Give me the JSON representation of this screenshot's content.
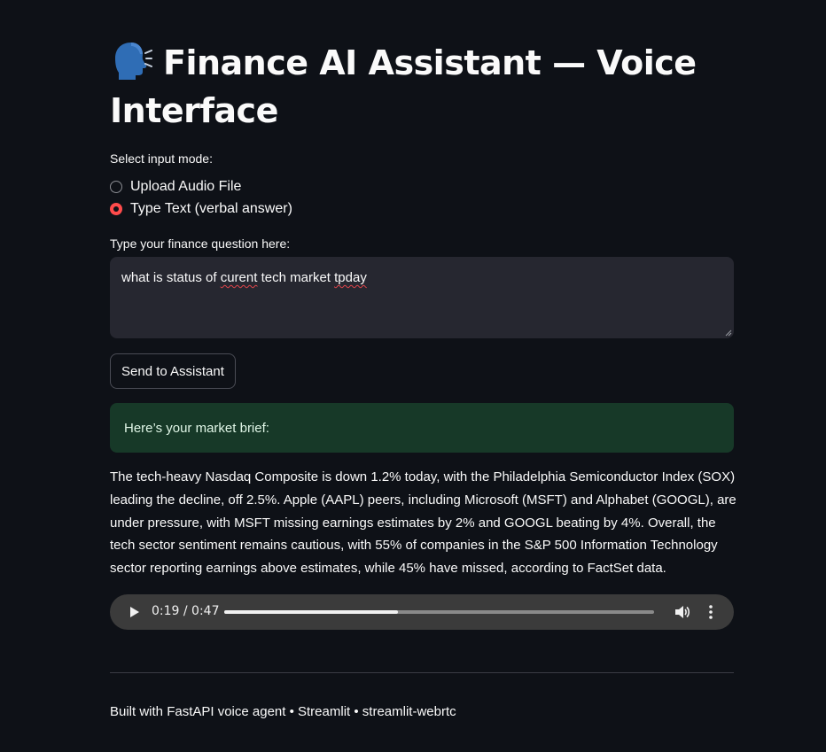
{
  "header": {
    "title": "Finance AI Assistant — Voice Interface",
    "title_icon": "speaking-head-emoji"
  },
  "input_mode": {
    "label": "Select input mode:",
    "options": [
      {
        "label": "Upload Audio File",
        "selected": false
      },
      {
        "label": "Type Text (verbal answer)",
        "selected": true
      }
    ]
  },
  "question": {
    "label": "Type your finance question here:",
    "value_parts": [
      "what is status of ",
      "curent",
      " tech market ",
      "tpday"
    ]
  },
  "send_button": {
    "label": "Send to Assistant"
  },
  "success": {
    "text": "Here’s your market brief:"
  },
  "answer": {
    "text": "The tech-heavy Nasdaq Composite is down 1.2% today, with the Philadelphia Semiconductor Index (SOX) leading the decline, off 2.5%. Apple (AAPL) peers, including Microsoft (MSFT) and Alphabet (GOOGL), are under pressure, with MSFT missing earnings estimates by 2% and GOOGL beating by 4%. Overall, the tech sector sentiment remains cautious, with 55% of companies in the S&P 500 Information Technology sector reporting earnings above estimates, while 45% have missed, according to FactSet data."
  },
  "audio_player": {
    "time": "0:19 / 0:47",
    "progress": 0.4043
  },
  "footer": {
    "text": "Built with FastAPI voice agent • Streamlit • streamlit-webrtc"
  },
  "colors": {
    "background": "#0e1117",
    "accent": "#ff4b4b",
    "success_bg": "#173928",
    "input_bg": "#262730"
  }
}
